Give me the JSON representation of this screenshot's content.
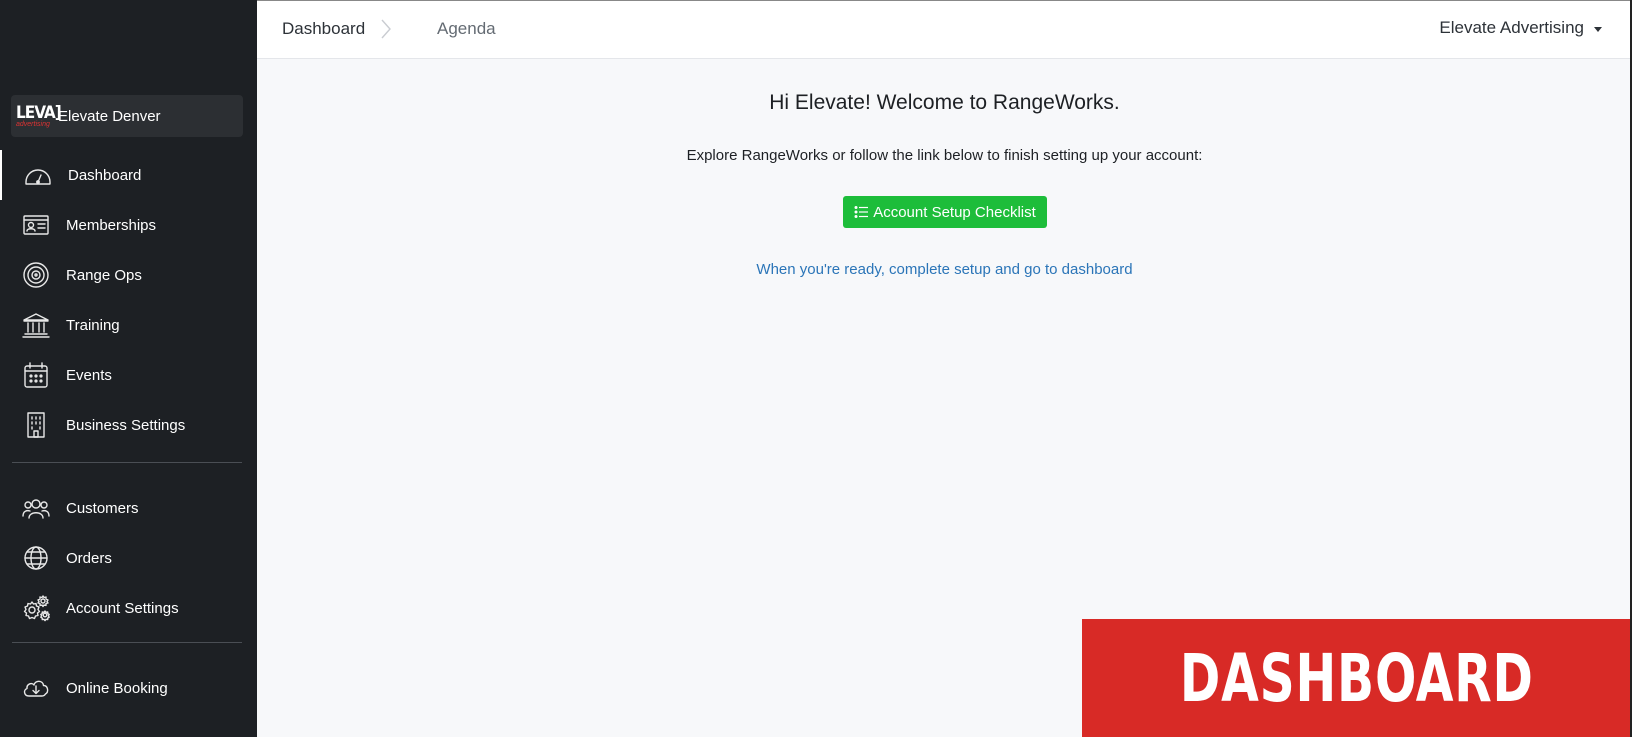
{
  "sidebar": {
    "account": {
      "logo_text": "LEVA]",
      "logo_sub": "advertising",
      "name": "Elevate Denver"
    },
    "items": [
      {
        "label": "Dashboard",
        "icon": "speedometer-icon"
      },
      {
        "label": "Memberships",
        "icon": "id-card-icon"
      },
      {
        "label": "Range Ops",
        "icon": "target-icon"
      },
      {
        "label": "Training",
        "icon": "institution-icon"
      },
      {
        "label": "Events",
        "icon": "calendar-icon"
      },
      {
        "label": "Business Settings",
        "icon": "building-icon"
      },
      {
        "label": "Customers",
        "icon": "people-icon"
      },
      {
        "label": "Orders",
        "icon": "globe-icon"
      },
      {
        "label": "Account Settings",
        "icon": "gears-icon"
      },
      {
        "label": "Online Booking",
        "icon": "cloud-download-icon"
      }
    ]
  },
  "header": {
    "breadcrumb": [
      "Dashboard",
      "Agenda"
    ],
    "org_menu": "Elevate Advertising"
  },
  "main": {
    "welcome": "Hi Elevate! Welcome to RangeWorks.",
    "explore": "Explore RangeWorks or follow the link below to finish setting up your account:",
    "setup_button": "Account Setup Checklist",
    "ready_link": "When you're ready, complete setup and go to dashboard"
  },
  "overlay": {
    "banner_text": "DASHBOARD"
  },
  "colors": {
    "sidebar_bg": "#1d2024",
    "accent_green": "#1dbd3a",
    "link_blue": "#2b75b8",
    "banner_red": "#d82a26"
  }
}
